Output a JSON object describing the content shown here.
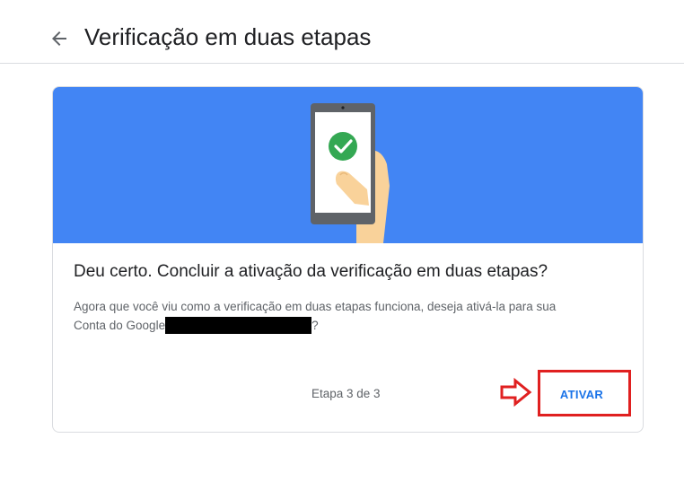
{
  "header": {
    "title": "Verificação em duas etapas",
    "back_icon": "arrow-back-icon"
  },
  "card": {
    "illustration": "phone-check-illustration",
    "heading": "Deu certo. Concluir a ativação da verificação em duas etapas?",
    "body_line1": "Agora que você viu como a verificação em duas etapas funciona, deseja ativá-la para sua",
    "body_line2_prefix": "Conta do Google",
    "body_line2_suffix": "?",
    "step_label": "Etapa 3 de 3",
    "activate_label": "ATIVAR"
  },
  "colors": {
    "banner": "#4285f4",
    "check": "#34a853",
    "link": "#1a73e8",
    "annotation": "#e02020"
  }
}
